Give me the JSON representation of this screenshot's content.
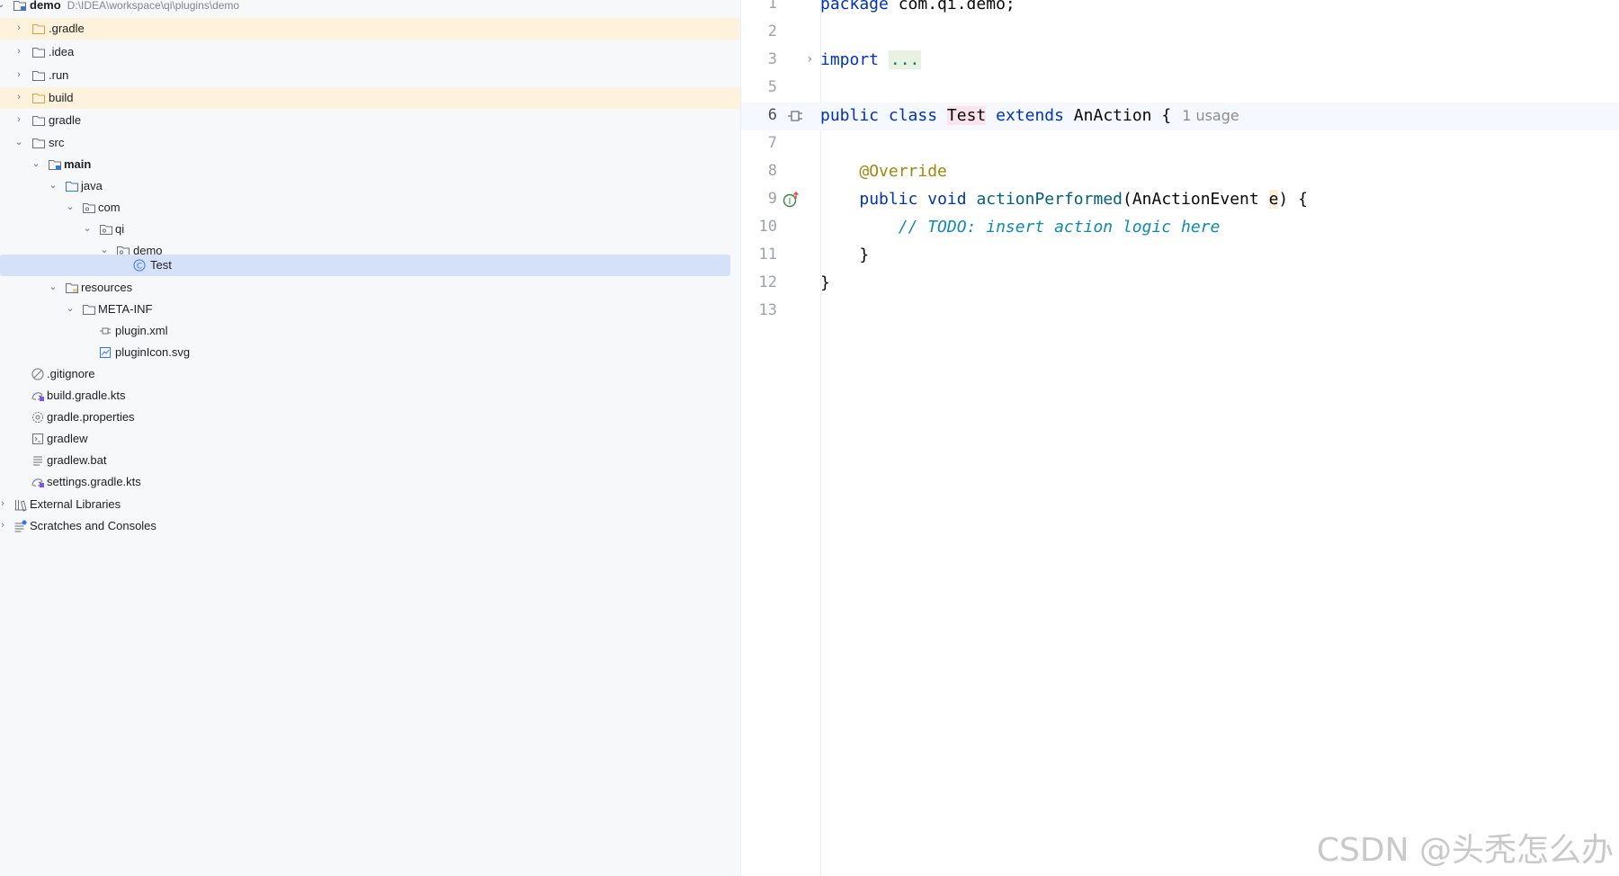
{
  "project_tree": {
    "root": {
      "name": "demo",
      "path": "D:\\IDEA\\workspace\\qi\\plugins\\demo"
    },
    "items": [
      {
        "label": ".gradle",
        "icon": "folder-icon"
      },
      {
        "label": ".idea",
        "icon": "folder-icon"
      },
      {
        "label": ".run",
        "icon": "folder-icon"
      },
      {
        "label": "build",
        "icon": "folder-icon"
      },
      {
        "label": "gradle",
        "icon": "folder-icon"
      },
      {
        "label": "src",
        "icon": "folder-icon"
      },
      {
        "label": "main",
        "icon": "module-folder-icon"
      },
      {
        "label": "java",
        "icon": "source-folder-icon"
      },
      {
        "label": "com",
        "icon": "package-icon"
      },
      {
        "label": "qi",
        "icon": "package-icon"
      },
      {
        "label": "demo",
        "icon": "package-icon"
      },
      {
        "label": "Test",
        "icon": "class-icon"
      },
      {
        "label": "resources",
        "icon": "resources-folder-icon"
      },
      {
        "label": "META-INF",
        "icon": "folder-icon"
      },
      {
        "label": "plugin.xml",
        "icon": "plugin-xml-icon"
      },
      {
        "label": "pluginIcon.svg",
        "icon": "svg-file-icon"
      },
      {
        "label": ".gitignore",
        "icon": "ignore-file-icon"
      },
      {
        "label": "build.gradle.kts",
        "icon": "gradle-kts-icon"
      },
      {
        "label": "gradle.properties",
        "icon": "properties-gear-icon"
      },
      {
        "label": "gradlew",
        "icon": "shell-script-icon"
      },
      {
        "label": "gradlew.bat",
        "icon": "text-file-icon"
      },
      {
        "label": "settings.gradle.kts",
        "icon": "gradle-kts-icon"
      },
      {
        "label": "External Libraries",
        "icon": "libraries-icon"
      },
      {
        "label": "Scratches and Consoles",
        "icon": "scratches-icon"
      }
    ]
  },
  "editor": {
    "line_numbers": [
      "1",
      "2",
      "3",
      "5",
      "6",
      "7",
      "8",
      "9",
      "10",
      "11",
      "12",
      "13"
    ],
    "code": {
      "l1_kw": "package",
      "l1_rest": " com.qi.demo;",
      "l3_kw": "import",
      "l3_fold": "...",
      "l6_kw1": "public",
      "l6_kw2": "class",
      "l6_name": "Test",
      "l6_kw3": "extends",
      "l6_rest": " AnAction {",
      "l6_hint": "1 usage",
      "l8_ann": "@Override",
      "l9_kw1": "public",
      "l9_kw2": "void",
      "l9_method": "actionPerformed",
      "l9_type": "(AnActionEvent ",
      "l9_param": "e",
      "l9_end": ") {",
      "l10_cmt": "// ",
      "l10_todo": "TODO: insert action logic here",
      "l11": "}",
      "l12": "}"
    }
  },
  "watermark": "CSDN @头秃怎么办"
}
